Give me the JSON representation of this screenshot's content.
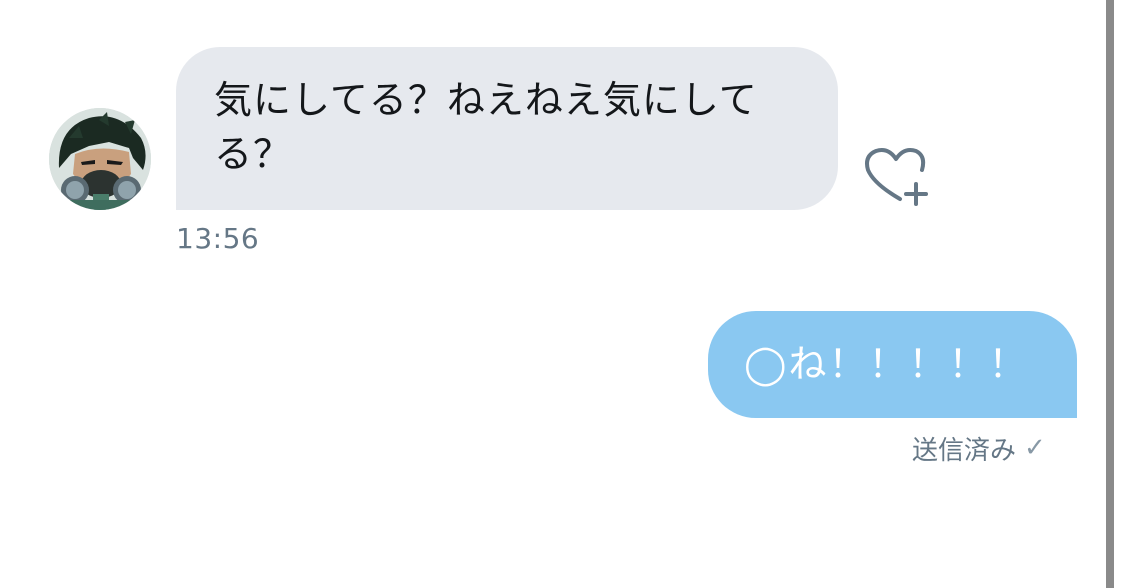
{
  "incoming": {
    "text": "気にしてる？ねえねえ気にしてる？",
    "time": "13:56",
    "like_icon": "heart-plus-icon"
  },
  "outgoing": {
    "text": "◯ね！！！！！",
    "status": "送信済み",
    "status_icon": "✓"
  },
  "colors": {
    "incoming_bubble": "#e6e9ee",
    "outgoing_bubble": "#8ac8f1",
    "meta_text": "#657786"
  }
}
